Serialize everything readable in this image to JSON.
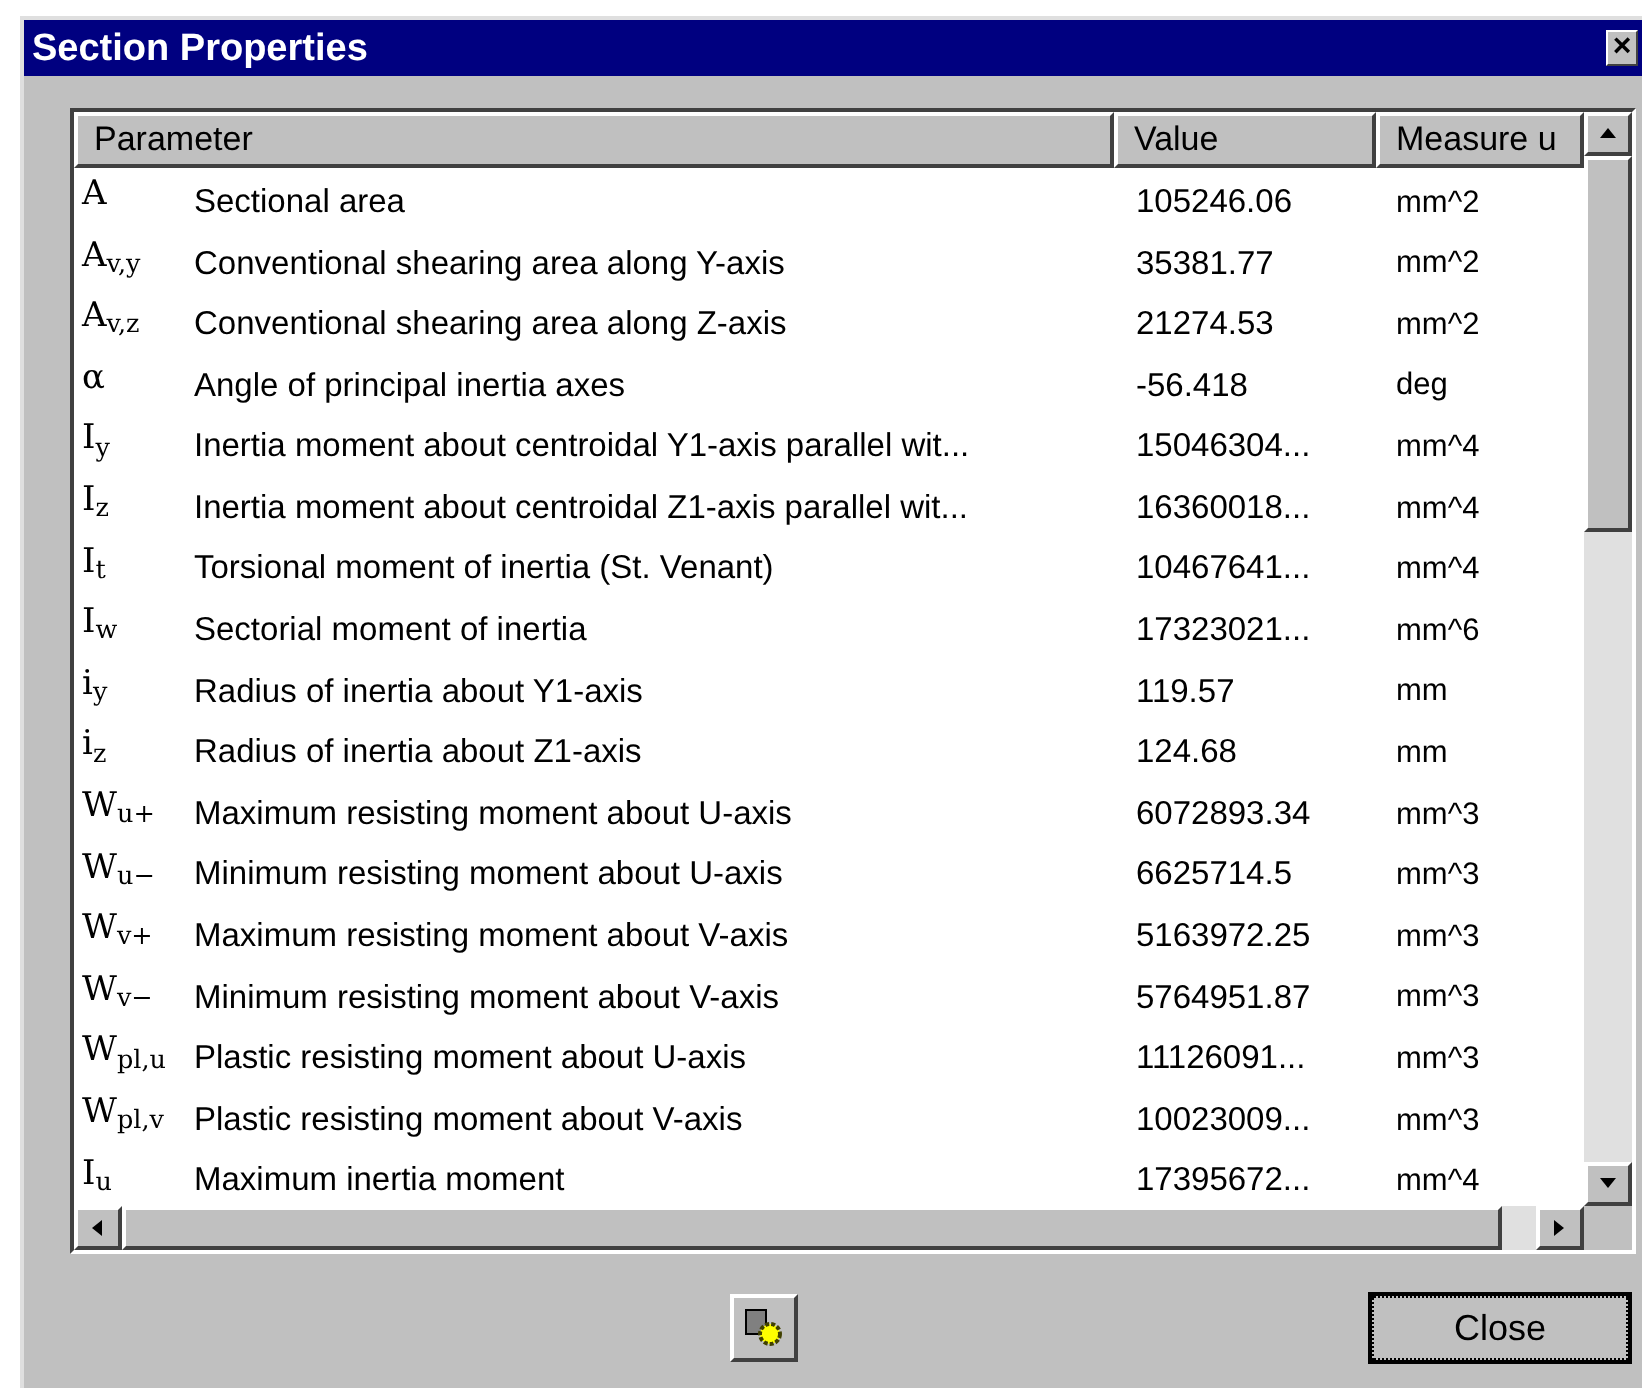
{
  "window": {
    "title": "Section Properties",
    "close": "×"
  },
  "table": {
    "columns": [
      "Parameter",
      "Value",
      "Measure u"
    ],
    "rows": [
      {
        "symbol": "A",
        "description": "Sectional area",
        "value": "105246.06",
        "unit": "mm^2"
      },
      {
        "symbol": "A$_{v,y}$",
        "description": "Conventional shearing area along Y-axis",
        "value": "35381.77",
        "unit": "mm^2"
      },
      {
        "symbol": "A$_{v,z}$",
        "description": "Conventional shearing area along Z-axis",
        "value": "21274.53",
        "unit": "mm^2"
      },
      {
        "symbol": "α",
        "description": "Angle of principal inertia axes",
        "value": "-56.418",
        "unit": "deg"
      },
      {
        "symbol": "I$_{y}$",
        "description": "Inertia moment about centroidal Y1-axis parallel wit...",
        "value": "15046304...",
        "unit": "mm^4"
      },
      {
        "symbol": "I$_{z}$",
        "description": "Inertia moment about centroidal Z1-axis parallel wit...",
        "value": "16360018...",
        "unit": "mm^4"
      },
      {
        "symbol": "I$_{t}$",
        "description": "Torsional moment of inertia (St. Venant)",
        "value": "10467641...",
        "unit": "mm^4"
      },
      {
        "symbol": "I$_{w}$",
        "description": "Sectorial moment of inertia",
        "value": "17323021...",
        "unit": "mm^6"
      },
      {
        "symbol": "i$_{y}$",
        "description": "Radius of inertia about Y1-axis",
        "value": "119.57",
        "unit": "mm"
      },
      {
        "symbol": "i$_{z}$",
        "description": "Radius of inertia about Z1-axis",
        "value": "124.68",
        "unit": "mm"
      },
      {
        "symbol": "W$_{u+}$",
        "description": "Maximum resisting moment about U-axis",
        "value": "6072893.34",
        "unit": "mm^3"
      },
      {
        "symbol": "W$_{u−}$",
        "description": "Minimum resisting moment about U-axis",
        "value": "6625714.5",
        "unit": "mm^3"
      },
      {
        "symbol": "W$_{v+}$",
        "description": "Maximum resisting moment about V-axis",
        "value": "5163972.25",
        "unit": "mm^3"
      },
      {
        "symbol": "W$_{v−}$",
        "description": "Minimum resisting moment about V-axis",
        "value": "5764951.87",
        "unit": "mm^3"
      },
      {
        "symbol": "W$_{pl,u}$",
        "description": "Plastic resisting moment about U-axis",
        "value": "11126091...",
        "unit": "mm^3"
      },
      {
        "symbol": "W$_{pl,v}$",
        "description": "Plastic resisting moment about V-axis",
        "value": "10023009...",
        "unit": "mm^3"
      },
      {
        "symbol": "I$_{u}$",
        "description": "Maximum inertia moment",
        "value": "17395672...",
        "unit": "mm^4"
      }
    ]
  },
  "buttons": {
    "close": "Close"
  }
}
